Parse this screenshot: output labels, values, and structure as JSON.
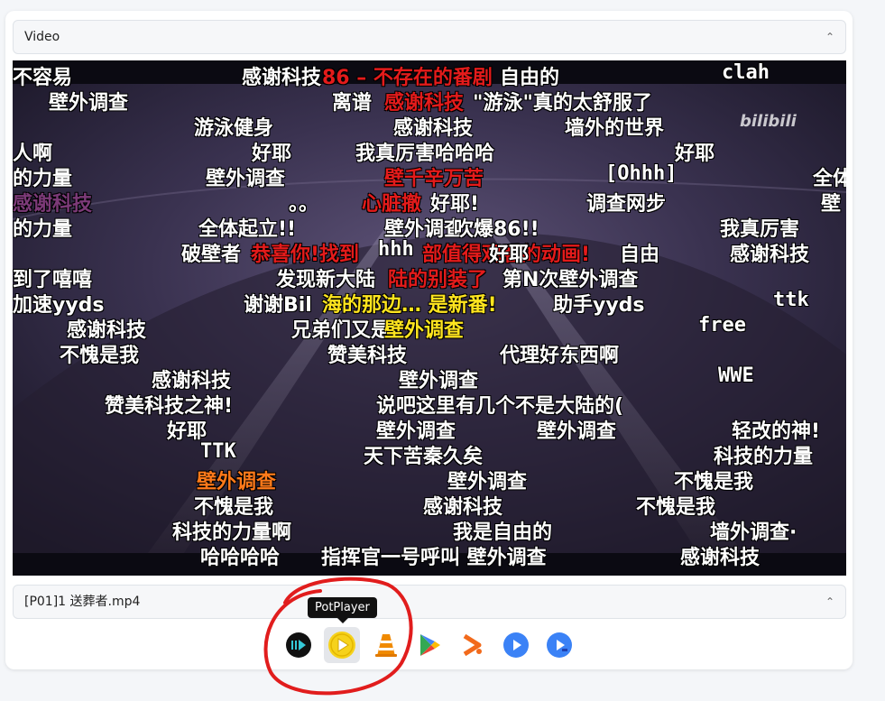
{
  "video_select": {
    "value": "Video"
  },
  "file_select": {
    "value": "[P01]1 送葬者.mp4"
  },
  "tooltip": {
    "text": "PotPlayer"
  },
  "watermark": "bilibili",
  "players": [
    {
      "name": "IINA",
      "icon": "iina-icon",
      "color": "#111111"
    },
    {
      "name": "PotPlayer",
      "icon": "potplayer-icon",
      "color": "#f6d21b",
      "active": true
    },
    {
      "name": "VLC",
      "icon": "vlc-icon",
      "color": "#f08a00"
    },
    {
      "name": "Google Play",
      "icon": "play-store-icon",
      "color": "#34a853"
    },
    {
      "name": "Infuse",
      "icon": "infuse-icon",
      "color": "#f26a1b"
    },
    {
      "name": "MX Player",
      "icon": "mx-player-icon",
      "color": "#3b82f6"
    },
    {
      "name": "MX Player Pro",
      "icon": "mx-player-pro-icon",
      "color": "#3b82f6"
    }
  ],
  "danmaku": [
    {
      "text": "不容易",
      "color": "white"
    },
    {
      "text": "感谢科技",
      "color": "white"
    },
    {
      "text": "86 – 不存在的番剧",
      "color": "red"
    },
    {
      "text": "自由的",
      "color": "white"
    },
    {
      "text": "clah",
      "color": "white"
    },
    {
      "text": "壁外调查",
      "color": "white"
    },
    {
      "text": "离谱",
      "color": "white"
    },
    {
      "text": "感谢科技",
      "color": "red"
    },
    {
      "text": "\"游泳\"真的太舒服了",
      "color": "white"
    },
    {
      "text": "游泳健身",
      "color": "white"
    },
    {
      "text": "感谢科技",
      "color": "white"
    },
    {
      "text": "墙外的世界",
      "color": "white"
    },
    {
      "text": "人啊",
      "color": "white"
    },
    {
      "text": "好耶",
      "color": "white"
    },
    {
      "text": "我真厉害哈哈哈",
      "color": "white"
    },
    {
      "text": "好耶",
      "color": "white"
    },
    {
      "text": "的力量",
      "color": "white"
    },
    {
      "text": "壁外调查",
      "color": "white"
    },
    {
      "text": "壁千辛万苦",
      "color": "red"
    },
    {
      "text": "[Ohhh]",
      "color": "white"
    },
    {
      "text": "全体",
      "color": "white"
    },
    {
      "text": "感谢科技",
      "color": "purple"
    },
    {
      "text": "。。",
      "color": "white"
    },
    {
      "text": "心脏撤",
      "color": "red"
    },
    {
      "text": "好耶!",
      "color": "white"
    },
    {
      "text": "调查网步",
      "color": "white"
    },
    {
      "text": "壁",
      "color": "white"
    },
    {
      "text": "的力量",
      "color": "white"
    },
    {
      "text": "全体起立!!",
      "color": "white"
    },
    {
      "text": "壁外调查",
      "color": "white"
    },
    {
      "text": "吹爆86!!",
      "color": "white"
    },
    {
      "text": "我真厉害",
      "color": "white"
    },
    {
      "text": "破壁者",
      "color": "white"
    },
    {
      "text": "恭喜你!找到",
      "color": "red"
    },
    {
      "text": "hhh",
      "color": "white"
    },
    {
      "text": "部值得观看的动画!",
      "color": "red"
    },
    {
      "text": "好耶",
      "color": "white"
    },
    {
      "text": "自由",
      "color": "white"
    },
    {
      "text": "感谢科技",
      "color": "white"
    },
    {
      "text": "到了嘻嘻",
      "color": "white"
    },
    {
      "text": "发现新大陆",
      "color": "white"
    },
    {
      "text": "陆的别装了",
      "color": "red"
    },
    {
      "text": "第N次壁外调查",
      "color": "white"
    },
    {
      "text": "加速yyds",
      "color": "white"
    },
    {
      "text": "谢谢Bil",
      "color": "white"
    },
    {
      "text": "海的那边… 是新番!",
      "color": "yellow"
    },
    {
      "text": "助手yyds",
      "color": "white"
    },
    {
      "text": "ttk",
      "color": "white"
    },
    {
      "text": "感谢科技",
      "color": "white"
    },
    {
      "text": "兄弟们又是",
      "color": "white"
    },
    {
      "text": "壁外调查",
      "color": "yellow"
    },
    {
      "text": "free",
      "color": "white"
    },
    {
      "text": "不愧是我",
      "color": "white"
    },
    {
      "text": "赞美科技",
      "color": "white"
    },
    {
      "text": "代理好东西啊",
      "color": "white"
    },
    {
      "text": "感谢科技",
      "color": "white"
    },
    {
      "text": "壁外调查",
      "color": "white"
    },
    {
      "text": "WWE",
      "color": "white"
    },
    {
      "text": "赞美科技之神!",
      "color": "white"
    },
    {
      "text": "说吧这里有几个不是大陆的(",
      "color": "white"
    },
    {
      "text": "好耶",
      "color": "white"
    },
    {
      "text": "壁外调查",
      "color": "white"
    },
    {
      "text": "壁外调查",
      "color": "white"
    },
    {
      "text": "轻改的神!",
      "color": "white"
    },
    {
      "text": "TTK",
      "color": "white"
    },
    {
      "text": "天下苦秦久矣",
      "color": "white"
    },
    {
      "text": "科技的力量",
      "color": "white"
    },
    {
      "text": "壁外调查",
      "color": "orange"
    },
    {
      "text": "壁外调查",
      "color": "white"
    },
    {
      "text": "不愧是我",
      "color": "white"
    },
    {
      "text": "不愧是我",
      "color": "white"
    },
    {
      "text": "感谢科技",
      "color": "white"
    },
    {
      "text": "不愧是我",
      "color": "white"
    },
    {
      "text": "科技的力量啊",
      "color": "white"
    },
    {
      "text": "我是自由的",
      "color": "white"
    },
    {
      "text": "墙外调查·",
      "color": "white"
    },
    {
      "text": "哈哈哈哈",
      "color": "white"
    },
    {
      "text": "指挥官一号呼叫 壁外调查",
      "color": "white"
    },
    {
      "text": "感谢科技",
      "color": "white"
    }
  ]
}
